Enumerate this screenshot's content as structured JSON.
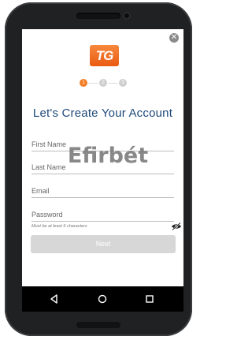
{
  "app": {
    "logo_text": "TG",
    "title": "Let's Create Your Account",
    "steps": [
      "1",
      "2",
      "3"
    ],
    "active_step": 1
  },
  "form": {
    "first_name_label": "First Name",
    "last_name_label": "Last Name",
    "email_label": "Email",
    "password_label": "Password",
    "password_hint": "Must be at least 6 characters",
    "next_label": "Next"
  },
  "watermark": "Efirbét",
  "icons": {
    "close": "close-icon",
    "show_password": "eye-slash-icon",
    "back": "back-triangle-icon",
    "home": "home-circle-icon",
    "recent": "recent-apps-square-icon"
  },
  "colors": {
    "accent": "#f27d26",
    "title": "#1f4a7a",
    "button_disabled": "#d7d7d7"
  }
}
